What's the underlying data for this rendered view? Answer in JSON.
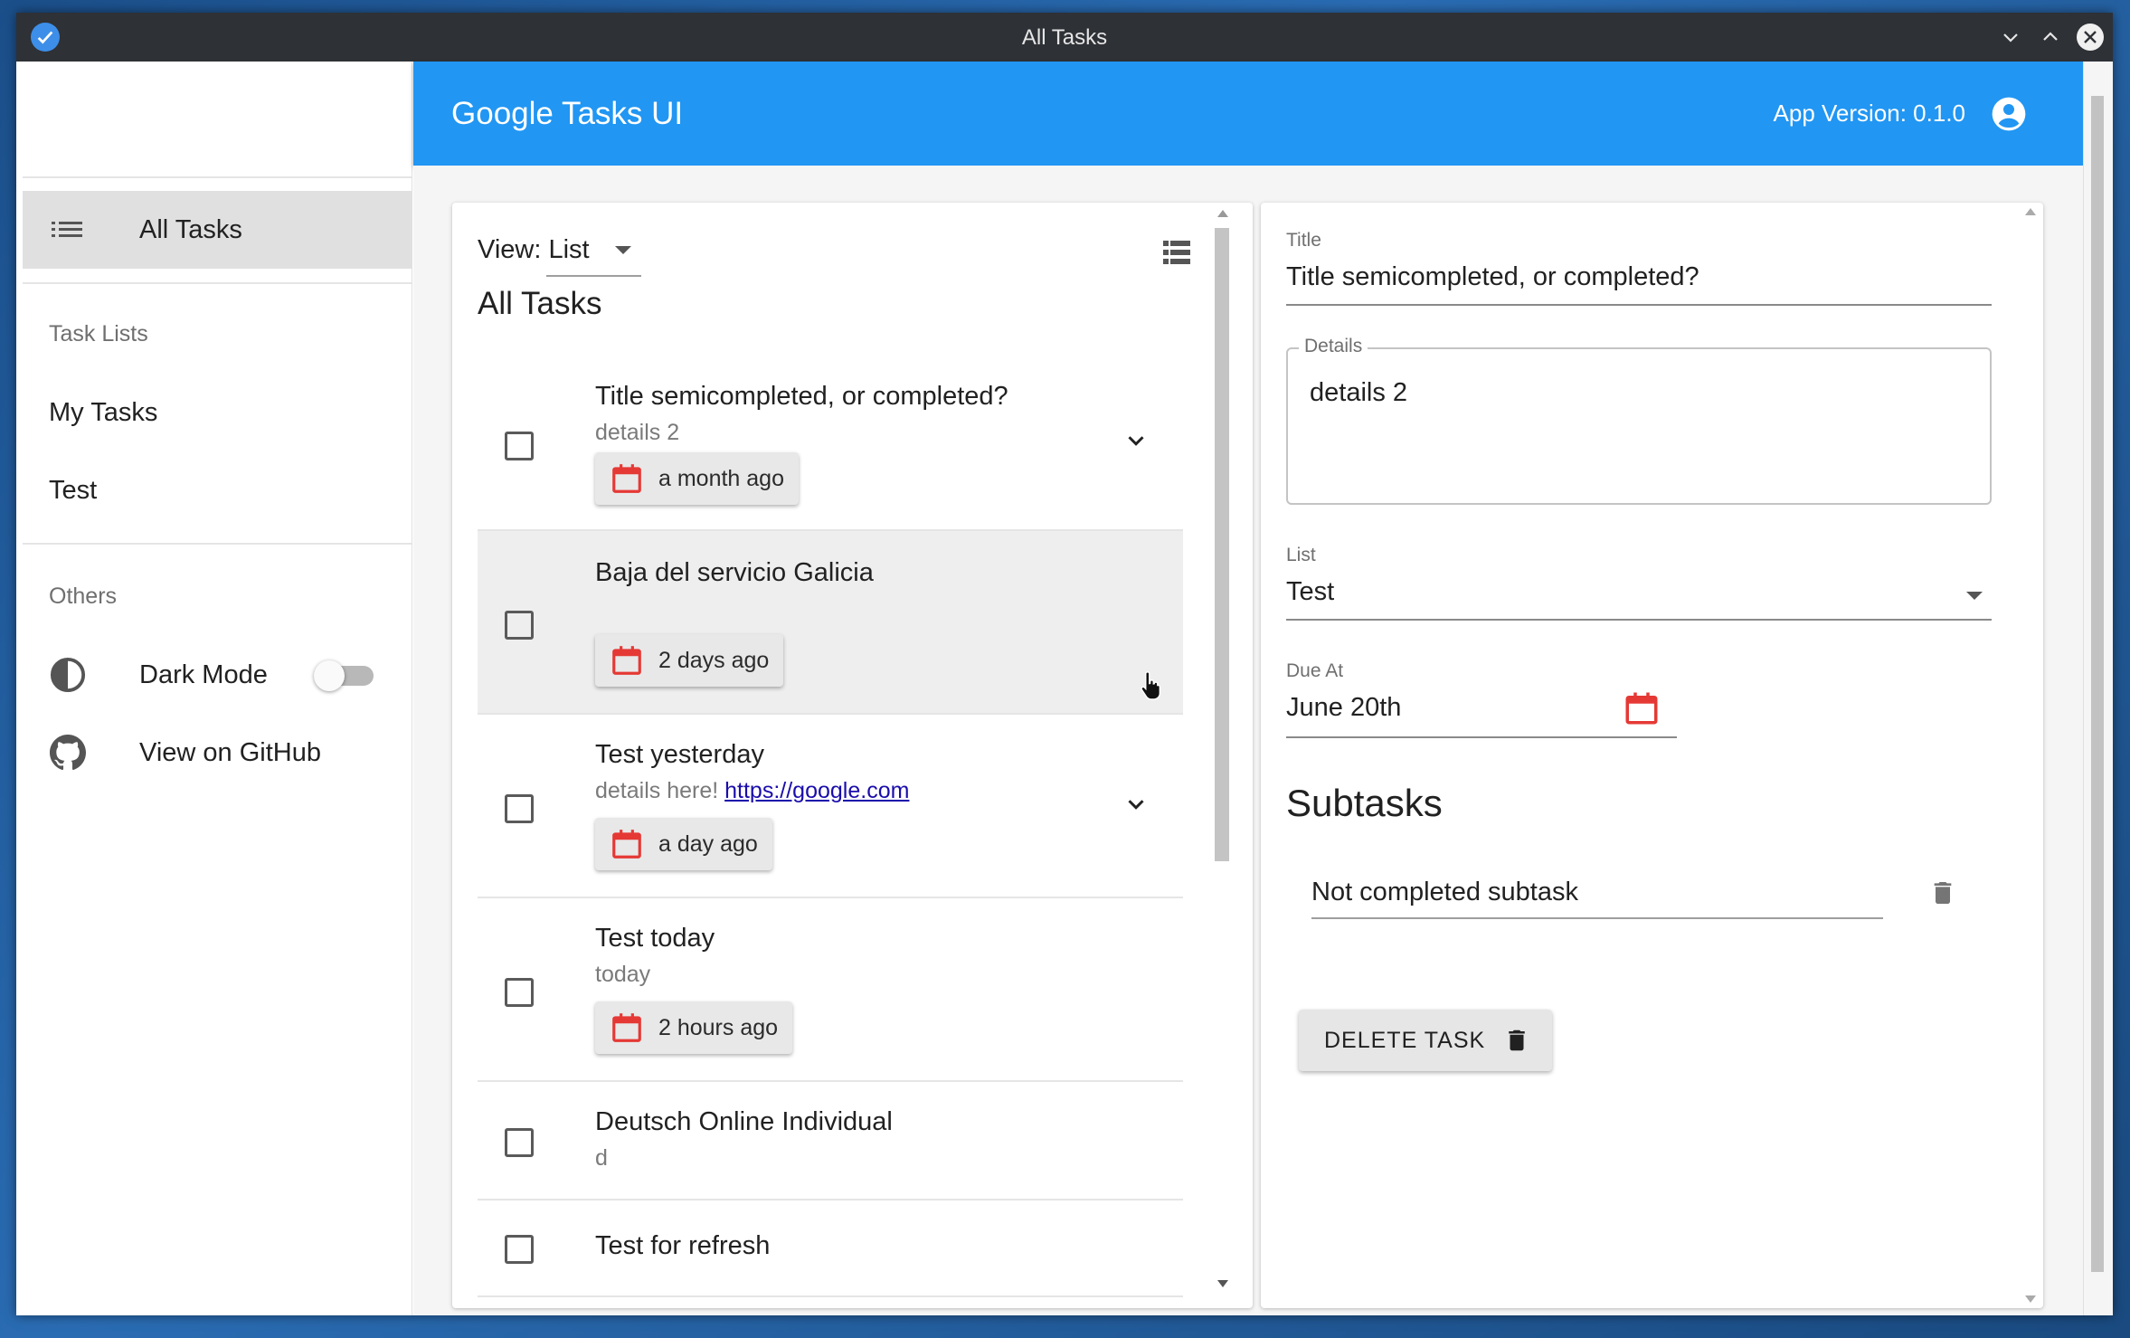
{
  "window": {
    "title": "All Tasks"
  },
  "appbar": {
    "brand": "Google Tasks UI",
    "version": "App Version: 0.1.0"
  },
  "sidebar": {
    "all_tasks": "All Tasks",
    "task_lists_header": "Task Lists",
    "lists": [
      "My Tasks",
      "Test"
    ],
    "others_header": "Others",
    "dark_mode": "Dark Mode",
    "dark_mode_on": false,
    "github": "View on GitHub"
  },
  "list_panel": {
    "view_prefix": "View:",
    "view_value": "List",
    "title": "All Tasks",
    "tasks": [
      {
        "title": "Title semicompleted, or completed?",
        "notes": "details 2",
        "due": "a month ago",
        "expandable": true
      },
      {
        "title": "Baja del servicio Galicia",
        "notes": "",
        "due": "2 days ago",
        "expandable": false
      },
      {
        "title": "Test yesterday",
        "notes": "details here! ",
        "link": "https://google.com",
        "due": "a day ago",
        "expandable": true
      },
      {
        "title": "Test today",
        "notes": "today",
        "due": "2 hours ago",
        "expandable": false
      },
      {
        "title": "Deutsch Online Individual",
        "notes": "d",
        "due": "",
        "expandable": false
      },
      {
        "title": "Test for refresh",
        "notes": "",
        "due": "",
        "expandable": false
      }
    ]
  },
  "detail": {
    "title_label": "Title",
    "title_value": "Title semicompleted, or completed?",
    "details_label": "Details",
    "details_value": "details 2",
    "list_label": "List",
    "list_value": "Test",
    "due_label": "Due At",
    "due_value": "June 20th",
    "subtasks_header": "Subtasks",
    "subtasks": [
      "Not completed subtask"
    ],
    "delete_button": "DELETE TASK"
  },
  "colors": {
    "appbar": "#2196f3",
    "calendar_icon": "#e53935",
    "link": "#1a0dab"
  }
}
